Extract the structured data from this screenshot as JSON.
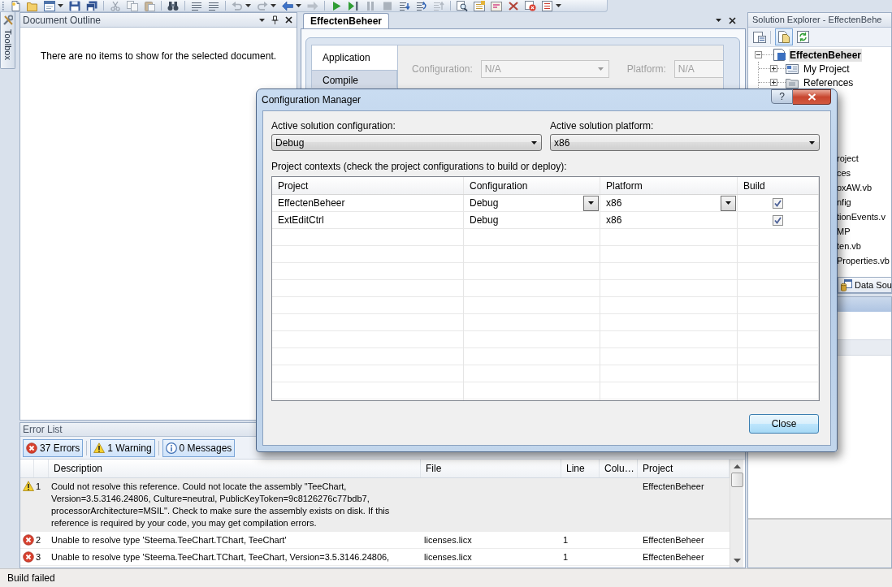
{
  "toolbox_tab": {
    "label": "Toolbox"
  },
  "document_outline": {
    "title": "Document Outline",
    "message": "There are no items to show for the selected document."
  },
  "document_tabs": [
    {
      "label": "EffectenBeheer",
      "selected": true
    }
  ],
  "property_pages": {
    "tabs": [
      {
        "label": "Application",
        "selected": true
      },
      {
        "label": "Compile",
        "selected": false
      }
    ],
    "fields": [
      {
        "label": "Configuration:",
        "value": "N/A",
        "disabled": true
      },
      {
        "label": "Platform:",
        "value": "N/A",
        "disabled": true
      }
    ]
  },
  "solution_explorer": {
    "title": "Solution Explorer - EffectenBehe",
    "tree": [
      {
        "label": "EffectenBeheer",
        "selected": true,
        "expanded": true,
        "children": [
          {
            "label": "My Project",
            "selected": false,
            "expanded": false
          },
          {
            "label": "References",
            "selected": false,
            "expanded": false
          }
        ]
      }
    ],
    "partly_covered_items": [
      {
        "label": "roject",
        "selected": false
      },
      {
        "label": "ces",
        "selected": false
      },
      {
        "label": "oxAW.vb",
        "selected": false
      },
      {
        "label": "nfig",
        "selected": false
      },
      {
        "label": "tionEvents.v",
        "selected": false
      },
      {
        "label": "MP",
        "selected": false
      },
      {
        "label": "ten.vb",
        "selected": false
      },
      {
        "label": "Properties.vb",
        "selected": false
      }
    ],
    "tabs": [
      {
        "label": "Data Sou",
        "selected": false
      }
    ]
  },
  "error_list": {
    "title": "Error List",
    "filters": [
      {
        "label": "37 Errors",
        "kind": "error",
        "selected": true
      },
      {
        "label": "1 Warning",
        "kind": "warning",
        "selected": true
      },
      {
        "label": "0 Messages",
        "kind": "message",
        "selected": true
      }
    ],
    "columns": [
      "Description",
      "File",
      "Line",
      "Colu…",
      "Project"
    ],
    "rows": [
      {
        "kind": "warning",
        "number": "1",
        "description": "Could not resolve this reference. Could not locate the assembly \"TeeChart, Version=3.5.3146.24806, Culture=neutral, PublicKeyToken=9c8126276c77bdb7, processorArchitecture=MSIL\". Check to make sure the assembly exists on disk. If this reference is required by your code, you may get compilation errors.",
        "project": "EffectenBeheer",
        "selected": true
      },
      {
        "kind": "error",
        "number": "2",
        "description": "Unable to resolve type 'Steema.TeeChart.TChart, TeeChart'",
        "file": "licenses.licx",
        "line": "1",
        "project": "EffectenBeheer",
        "selected": false
      },
      {
        "kind": "error",
        "number": "3",
        "description": "Unable to resolve type 'Steema.TeeChart.TChart, TeeChart, Version=3.5.3146.24806,",
        "file": "licenses.licx",
        "line": "1",
        "project": "EffectenBeheer",
        "selected": false
      }
    ]
  },
  "configuration_manager": {
    "title": "Configuration Manager",
    "help_button": "?",
    "active_configuration": {
      "label": "Active solution configuration:",
      "value": "Debug"
    },
    "active_platform": {
      "label": "Active solution platform:",
      "value": "x86"
    },
    "contexts_label": "Project contexts (check the project configurations to build or deploy):",
    "columns": [
      "Project",
      "Configuration",
      "Platform",
      "Build"
    ],
    "rows": [
      {
        "project": "EffectenBeheer",
        "configuration": "Debug",
        "platform": "x86",
        "build_checked": true,
        "selected": true
      },
      {
        "project": "ExtEditCtrl",
        "configuration": "Debug",
        "platform": "x86",
        "build_checked": true,
        "selected": false
      }
    ],
    "buttons": [
      {
        "label": "Close",
        "default": true
      }
    ]
  },
  "status_bar": {
    "text": "Build failed"
  }
}
